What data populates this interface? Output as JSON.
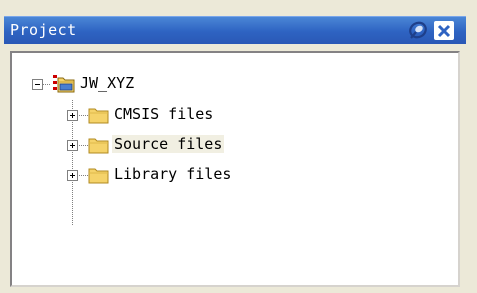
{
  "panel": {
    "title": "Project",
    "pin_icon": "pin-icon",
    "close_icon": "close-icon"
  },
  "tree": {
    "root": {
      "label": "JW_XYZ",
      "icon": "project-folder-icon",
      "expanded": true
    },
    "children": [
      {
        "label": "CMSIS files",
        "icon": "folder-icon",
        "expanded": false,
        "selected": false
      },
      {
        "label": "Source files",
        "icon": "folder-icon",
        "expanded": false,
        "selected": true
      },
      {
        "label": "Library files",
        "icon": "folder-icon",
        "expanded": false,
        "selected": false
      }
    ]
  },
  "colors": {
    "title_bar": "#2e63c2",
    "folder": "#f5d36a",
    "selection": "#f1efe2"
  }
}
